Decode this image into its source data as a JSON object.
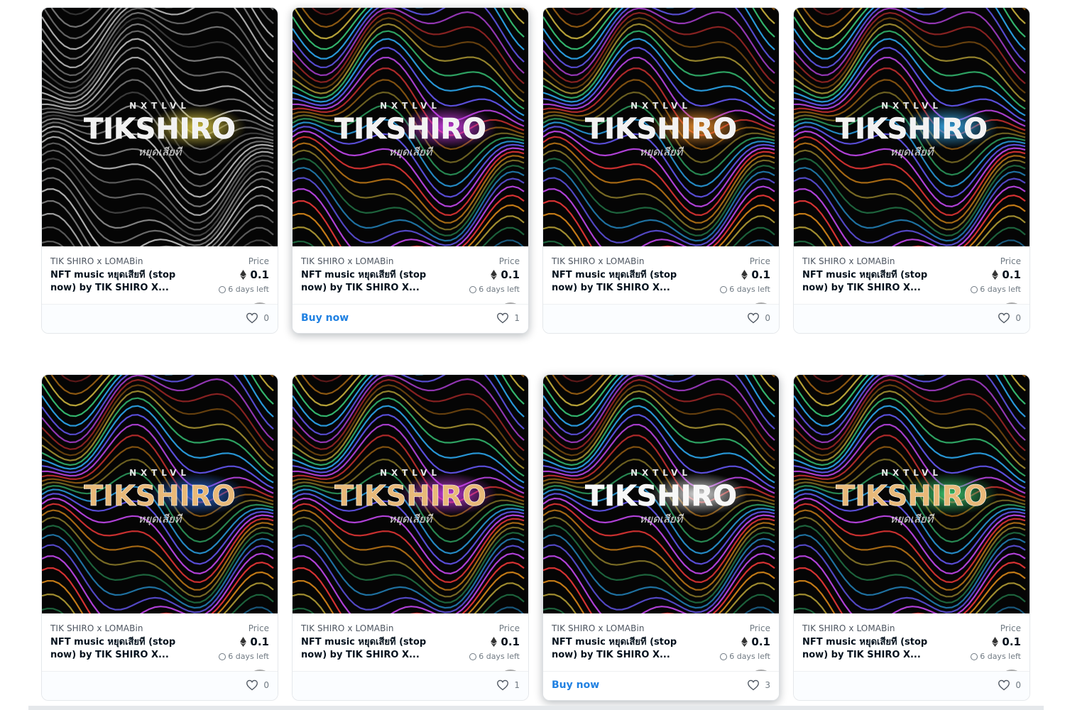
{
  "theme": {
    "accent": "#2081e2",
    "text": "#04111d",
    "muted": "#707a83"
  },
  "cards": [
    {
      "collection": "TIK SHIRO x LOMABin",
      "title": "NFT music หยุดเสียที (stop now) by TIK SHIRO X...",
      "price_label": "Price",
      "price": "0.1",
      "time_left": "6 days left",
      "likes": "0",
      "buy_label": "",
      "art": {
        "logo": "TIKSHIRO",
        "sublogo": "NXTLVL",
        "thai": "หยุดเสียที",
        "glow": "#f4e04a",
        "palette": "mono",
        "logo_fill": "#f2f2f2"
      }
    },
    {
      "collection": "TIK SHIRO x LOMABin",
      "title": "NFT music หยุดเสียที (stop now) by TIK SHIRO X...",
      "price_label": "Price",
      "price": "0.1",
      "time_left": "6 days left",
      "likes": "1",
      "buy_label": "Buy now",
      "art": {
        "logo": "TIKSHIRO",
        "sublogo": "NXTLVL",
        "thai": "หยุดเสียที",
        "glow": "#e040fb",
        "palette": "rainbow",
        "logo_fill": "#f2f2f2"
      }
    },
    {
      "collection": "TIK SHIRO x LOMABin",
      "title": "NFT music หยุดเสียที (stop now) by TIK SHIRO X...",
      "price_label": "Price",
      "price": "0.1",
      "time_left": "6 days left",
      "likes": "0",
      "buy_label": "",
      "art": {
        "logo": "TIKSHIRO",
        "sublogo": "NXTLVL",
        "thai": "หยุดเสียที",
        "glow": "#ff9a2e",
        "palette": "rainbow",
        "logo_fill": "#f2f2f2"
      }
    },
    {
      "collection": "TIK SHIRO x LOMABin",
      "title": "NFT music หยุดเสียที (stop now) by TIK SHIRO X...",
      "price_label": "Price",
      "price": "0.1",
      "time_left": "6 days left",
      "likes": "0",
      "buy_label": "",
      "art": {
        "logo": "TIKSHIRO",
        "sublogo": "NXTLVL",
        "thai": "หยุดเสียที",
        "glow": "#3ab8ff",
        "palette": "rainbow",
        "logo_fill": "#f2f2f2"
      }
    },
    {
      "collection": "TIK SHIRO x LOMABin",
      "title": "NFT music หยุดเสียที (stop now) by TIK SHIRO X...",
      "price_label": "Price",
      "price": "0.1",
      "time_left": "6 days left",
      "likes": "0",
      "buy_label": "",
      "art": {
        "logo": "TIKSHIRO",
        "sublogo": "NXTLVL",
        "thai": "หยุดเสียที",
        "glow": "#2f7bff",
        "palette": "rainbow",
        "logo_fill": "#e8b979"
      }
    },
    {
      "collection": "TIK SHIRO x LOMABin",
      "title": "NFT music หยุดเสียที (stop now) by TIK SHIRO X...",
      "price_label": "Price",
      "price": "0.1",
      "time_left": "6 days left",
      "likes": "1",
      "buy_label": "",
      "art": {
        "logo": "TIKSHIRO",
        "sublogo": "NXTLVL",
        "thai": "หยุดเสียที",
        "glow": "#e040fb",
        "palette": "rainbow",
        "logo_fill": "#e8b979"
      }
    },
    {
      "collection": "TIK SHIRO x LOMABin",
      "title": "NFT music หยุดเสียที (stop now) by TIK SHIRO X...",
      "price_label": "Price",
      "price": "0.1",
      "time_left": "6 days left",
      "likes": "3",
      "buy_label": "Buy now",
      "art": {
        "logo": "TIKSHIRO",
        "sublogo": "NXTLVL",
        "thai": "หยุดเสียที",
        "glow": "#ffffff",
        "palette": "rainbow",
        "logo_fill": "#f7f7f7"
      }
    },
    {
      "collection": "TIK SHIRO x LOMABin",
      "title": "NFT music หยุดเสียที (stop now) by TIK SHIRO X...",
      "price_label": "Price",
      "price": "0.1",
      "time_left": "6 days left",
      "likes": "0",
      "buy_label": "",
      "art": {
        "logo": "TIKSHIRO",
        "sublogo": "NXTLVL",
        "thai": "หยุดเสียที",
        "glow": "#42e07a",
        "palette": "rainbow",
        "logo_fill": "#e8b979"
      }
    }
  ]
}
